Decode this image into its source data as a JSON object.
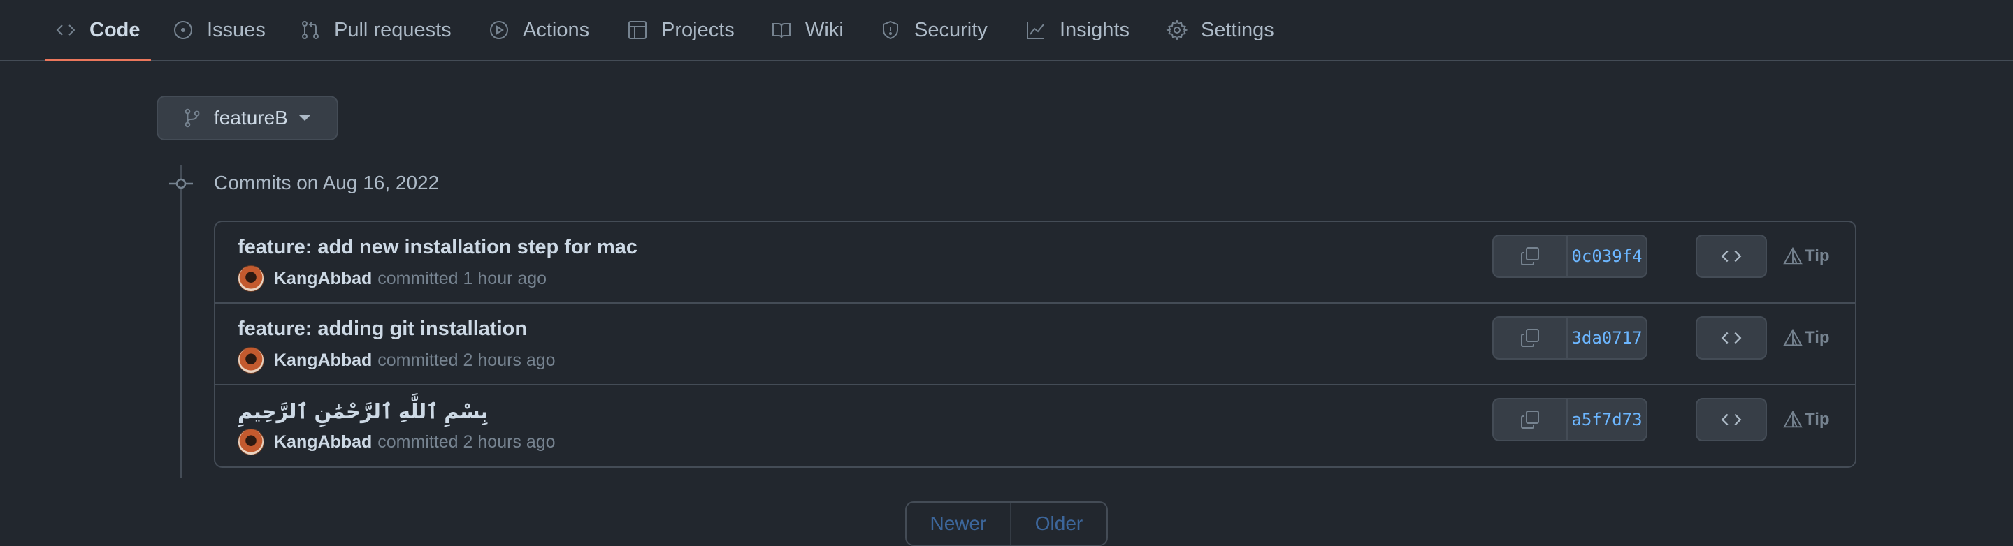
{
  "nav": {
    "items": [
      {
        "label": "Code",
        "icon": "code-icon",
        "active": true
      },
      {
        "label": "Issues",
        "icon": "issue-icon"
      },
      {
        "label": "Pull requests",
        "icon": "pull-request-icon"
      },
      {
        "label": "Actions",
        "icon": "play-icon"
      },
      {
        "label": "Projects",
        "icon": "table-icon"
      },
      {
        "label": "Wiki",
        "icon": "book-icon"
      },
      {
        "label": "Security",
        "icon": "shield-icon"
      },
      {
        "label": "Insights",
        "icon": "graph-icon"
      },
      {
        "label": "Settings",
        "icon": "gear-icon"
      }
    ],
    "active_color": "#ec775c"
  },
  "branch": {
    "name": "featureB"
  },
  "commits_heading": "Commits on Aug 16, 2022",
  "commits": [
    {
      "title": "feature: add new installation step for mac",
      "author": "KangAbbad",
      "time": "committed 1 hour ago",
      "sha": "0c039f4",
      "tip": "Tip"
    },
    {
      "title": "feature: adding git installation",
      "author": "KangAbbad",
      "time": "committed 2 hours ago",
      "sha": "3da0717",
      "tip": "Tip"
    },
    {
      "title": "بِسْمِ ٱللَّٰهِ ٱلرَّحْمَٰنِ ٱلرَّحِيمِ",
      "author": "KangAbbad",
      "time": "committed 2 hours ago",
      "sha": "a5f7d73",
      "tip": "Tip"
    }
  ],
  "pagination": {
    "newer": "Newer",
    "older": "Older"
  },
  "colors": {
    "background": "#22272e",
    "border": "#444c56",
    "link": "#6cb6ff"
  }
}
